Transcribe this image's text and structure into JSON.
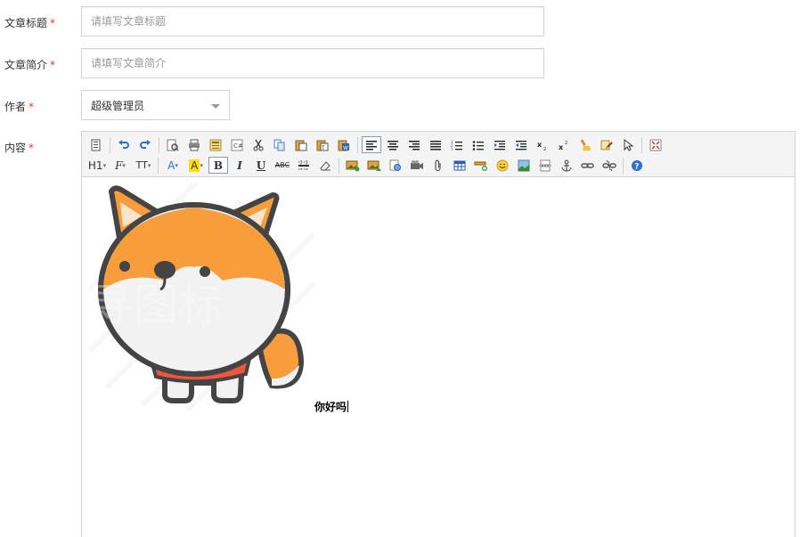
{
  "form": {
    "title": {
      "label": "文章标题",
      "required_mark": "*",
      "placeholder": "请填写文章标题",
      "value": ""
    },
    "summary": {
      "label": "文章简介",
      "required_mark": "*",
      "placeholder": "请填写文章简介",
      "value": ""
    },
    "author": {
      "label": "作者",
      "required_mark": "*",
      "selected": "超级管理员"
    },
    "content": {
      "label": "内容",
      "required_mark": "*"
    }
  },
  "editor": {
    "toolbar": {
      "heading_label": "H1",
      "font_family_label": "F",
      "font_size_label": "TT",
      "font_color_label": "A",
      "highlight_label": "A",
      "bold_label": "B",
      "italic_label": "I",
      "underline_label": "U",
      "strike_label": "ABC"
    },
    "body_text": "你好吗",
    "image_watermark": "寻图标"
  },
  "colors": {
    "required": "#ee3333",
    "active_button_border": "#7f9db9",
    "fox_orange": "#f89d3c",
    "fox_outline": "#444444",
    "scarf": "#f0563f",
    "help_blue": "#2a6fd6"
  }
}
